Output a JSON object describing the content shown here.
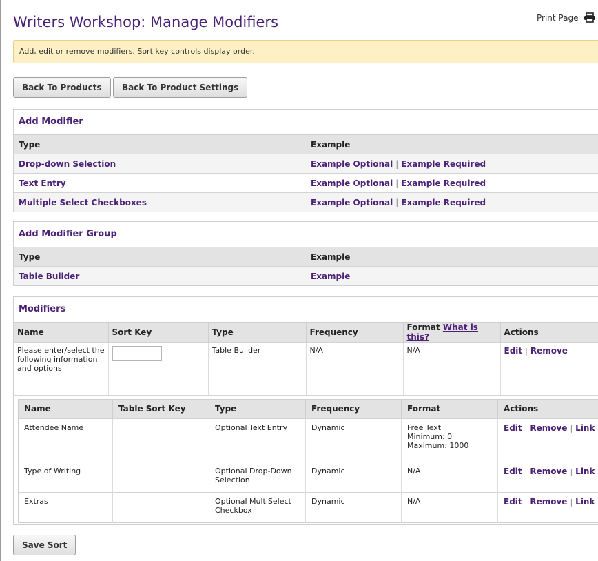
{
  "page": {
    "title": "Writers Workshop: Manage Modifiers",
    "print_label": "Print Page",
    "notice": "Add, edit or remove modifiers. Sort key controls display order."
  },
  "buttons": {
    "back_products": "Back To Products",
    "back_settings": "Back To Product Settings",
    "save_sort": "Save Sort"
  },
  "add_modifier": {
    "title": "Add Modifier",
    "headers": [
      "Type",
      "Example"
    ],
    "rows": [
      {
        "type": "Drop-down Selection",
        "optional": "Example Optional",
        "required": "Example Required"
      },
      {
        "type": "Text Entry",
        "optional": "Example Optional",
        "required": "Example Required"
      },
      {
        "type": "Multiple Select Checkboxes",
        "optional": "Example Optional",
        "required": "Example Required"
      }
    ]
  },
  "add_group": {
    "title": "Add Modifier Group",
    "headers": [
      "Type",
      "Example"
    ],
    "rows": [
      {
        "type": "Table Builder",
        "example": "Example"
      }
    ]
  },
  "modifiers": {
    "title": "Modifiers",
    "headers": {
      "name": "Name",
      "sort_key": "Sort Key",
      "type": "Type",
      "frequency": "Frequency",
      "format": "Format",
      "format_help": "What is this?",
      "actions": "Actions"
    },
    "row": {
      "name": "Please enter/select the following information and options",
      "sort_key": "",
      "type": "Table Builder",
      "frequency": "N/A",
      "format": "N/A",
      "edit": "Edit",
      "remove": "Remove"
    },
    "nested_headers": [
      "Name",
      "Table Sort Key",
      "Type",
      "Frequency",
      "Format",
      "Actions"
    ],
    "nested_rows": [
      {
        "name": "Attendee Name",
        "sort_key": "",
        "type": "Optional Text Entry",
        "frequency": "Dynamic",
        "format": [
          "Free Text",
          "Minimum: 0",
          "Maximum: 1000"
        ],
        "edit": "Edit",
        "remove": "Remove",
        "link": "Link"
      },
      {
        "name": "Type of Writing",
        "sort_key": "",
        "type": "Optional Drop-Down Selection",
        "frequency": "Dynamic",
        "format": [
          "N/A"
        ],
        "edit": "Edit",
        "remove": "Remove",
        "link": "Link"
      },
      {
        "name": "Extras",
        "sort_key": "",
        "type": "Optional MultiSelect Checkbox",
        "frequency": "Dynamic",
        "format": [
          "N/A"
        ],
        "edit": "Edit",
        "remove": "Remove",
        "link": "Link"
      }
    ]
  },
  "icons": {
    "print": "printer-icon"
  }
}
